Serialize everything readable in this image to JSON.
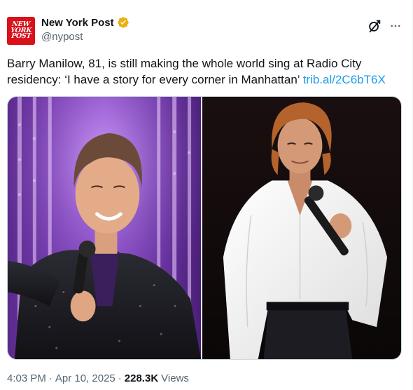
{
  "account": {
    "display_name": "New York Post",
    "handle": "@nypost",
    "avatar_lines": [
      "NEW",
      "YORK",
      "POST"
    ],
    "verified_color": "#e9b10f"
  },
  "tweet": {
    "text": "Barry Manilow, 81, is still making the whole world sing at Radio City residency: ‘I have a story for every corner in Manhattan’",
    "link_text": "trib.al/2C6bT6X"
  },
  "media": {
    "left_photo_icon": "older-singer-on-stage-photo",
    "right_photo_icon": "young-singer-white-shirt-photo"
  },
  "meta": {
    "time": "4:03 PM",
    "separator": "·",
    "date": "Apr 10, 2025",
    "views_count": "228.3K",
    "views_label": "Views"
  },
  "colors": {
    "link": "#1d9bf0",
    "secondary_text": "#536471",
    "brand_red": "#d9111b"
  },
  "icons": {
    "grok": "grok-icon",
    "more": "more-options-icon"
  }
}
